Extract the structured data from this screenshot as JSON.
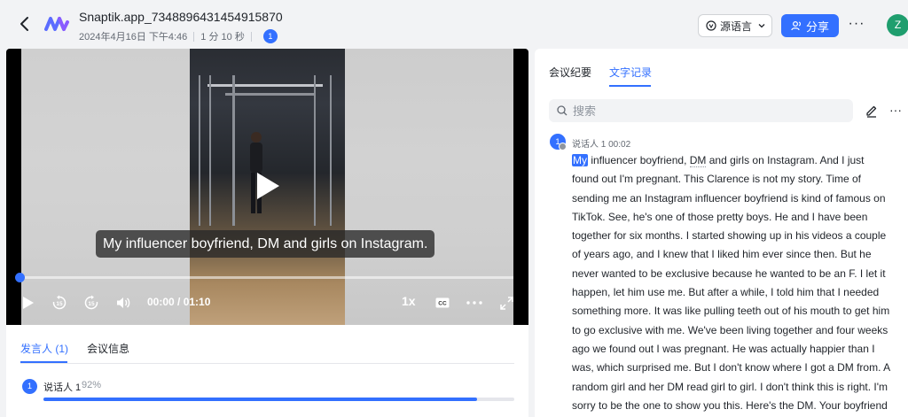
{
  "header": {
    "title": "Snaptik.app_7348896431454915870",
    "date": "2024年4月16日 下午4:46",
    "duration": "1 分 10 秒",
    "participant_count": "1",
    "source_language_label": "源语言",
    "share_label": "分享",
    "more_label": "···",
    "avatar_initial": "Z"
  },
  "video": {
    "caption": "My influencer boyfriend, DM and girls on Instagram.",
    "time": "00:00 / 01:10",
    "speed": "1x",
    "progress": 0.0
  },
  "left_panel": {
    "tabs": [
      "发言人 (1)",
      "会议信息"
    ],
    "speakers": [
      {
        "badge": "1",
        "name": "说话人 1",
        "percent": "92%",
        "share": 0.92
      }
    ]
  },
  "right_panel": {
    "tabs": [
      "会议纪要",
      "文字记录"
    ],
    "search_placeholder": "搜索",
    "more_label": "···",
    "transcript": [
      {
        "badge": "1",
        "speaker": "说话人 1",
        "time": "00:02",
        "highlight_word": "My",
        "before_dm": " influencer boyfriend, ",
        "dm_word": "DM",
        "text_rest": " and girls on Instagram. And I just found out I'm pregnant. This Clarence is not my story. Time of sending me an Instagram influencer boyfriend is kind of famous on TikTok. See, he's one of those pretty boys. He and I have been together for six months. I started showing up in his videos a couple of years ago, and I knew that I liked him ever since then. But he never wanted to be exclusive because he wanted to be an F. I let it happen, let him use me. But after a while, I told him that I needed something more. It was like pulling teeth out of his mouth to get him to go exclusive with me. We've been living together and four weeks ago we found out I was pregnant. He was actually happier than I was, which surprised me. But I don't know where I got a DM from. A random girl and her DM read girl to girl. I don't think this is right. I'm sorry to be the one to show you this. Here's the DM. Your boyfriend sent me his DM to her,"
      }
    ]
  },
  "colors": {
    "accent": "#3370ff",
    "avatar_bg": "#1f9e6e"
  }
}
